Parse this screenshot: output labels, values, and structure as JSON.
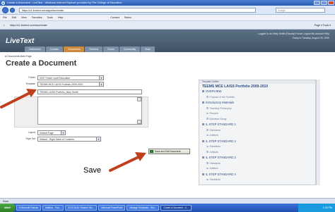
{
  "window": {
    "title": "Create a Document - LiveText - Windows Internet Explorer provided by The College of Education"
  },
  "address": {
    "url": "https://c1.livetext.com/app/doc/create",
    "search_placeholder": "Google"
  },
  "menu": {
    "items": [
      "File",
      "Edit",
      "View",
      "Favorites",
      "Tools",
      "Help"
    ],
    "convert": "Convert",
    "select": "Select"
  },
  "favorites": {
    "tab": "https://c1.livetext.com/doc/create"
  },
  "toolbar_right": "Page ▾  Tools ▾",
  "header": {
    "logo": "LiveText",
    "user_line": "Logged in as: Mary Smith (Faculty)    Forum    Logout    My Account    Help",
    "date_line": "Today is Tuesday, August 25, 2009",
    "tabs": [
      "Dashboard",
      "Courses",
      "Documents",
      "Reviews",
      "Forms",
      "Community",
      "Tools"
    ],
    "active_tab": "Documents"
  },
  "breadcrumb": "◄ Documents Main Page",
  "page_title": "Create a Document",
  "form": {
    "folder_label": "Folder",
    "folder_value": "2007 Folder Level Education",
    "template_label": "Template",
    "template_value": "TEEMS MCE LA/SS Portfolio 2009-2010",
    "title_label": "Title",
    "title_value": "TEEMS LA/SS Portfolio_Mary Smith",
    "layout_label": "Layout",
    "layout_value": "Default Page",
    "style_label": "Style Set",
    "style_value": "Default - Right Table of Contents",
    "save_button": "Save and Edit Document"
  },
  "outline": {
    "header": "Template Outline",
    "title": "TEEMS MCE LA/SS Portfolio 2009-2010",
    "items": [
      {
        "label": "OVERVIEW",
        "level": 1
      },
      {
        "label": "Purpose of the Portfolio",
        "level": 2
      },
      {
        "label": "Introductory Materials",
        "level": 1
      },
      {
        "label": "Teaching Philosophy",
        "level": 2
      },
      {
        "label": "Resume",
        "level": 2
      },
      {
        "label": "Narrative Essay",
        "level": 2
      },
      {
        "label": "IL STEP STANDARD 1",
        "level": 1
      },
      {
        "label": "Standards",
        "level": 2
      },
      {
        "label": "Artifacts",
        "level": 2
      },
      {
        "label": "IL STEP STANDARD 2",
        "level": 1
      },
      {
        "label": "Standards",
        "level": 2
      },
      {
        "label": "Artifacts",
        "level": 2
      },
      {
        "label": "IL STEP STANDARD 3",
        "level": 1
      },
      {
        "label": "Standards",
        "level": 2
      },
      {
        "label": "Artifacts",
        "level": 2
      },
      {
        "label": "IL STEP STANDARD 4",
        "level": 1
      },
      {
        "label": "Standards",
        "level": 2
      }
    ]
  },
  "status": {
    "text": "Done"
  },
  "taskbar": {
    "start": "start",
    "items": [
      "5 Microsoft Outlook",
      "Mailbox - Pau...",
      "EDCI 5443: Teacher Wo...",
      "Microsoft PowerPoint",
      "Manage Templates - Win...",
      "Create a Document - Li..."
    ],
    "clock": "1:25 PM"
  },
  "annotation": {
    "save_label": "Save"
  },
  "colors": {
    "header": "#4a5d72",
    "active_tab": "#cb8a3c",
    "arrow": "#c0401e",
    "taskbar": "#2a5fc4"
  }
}
